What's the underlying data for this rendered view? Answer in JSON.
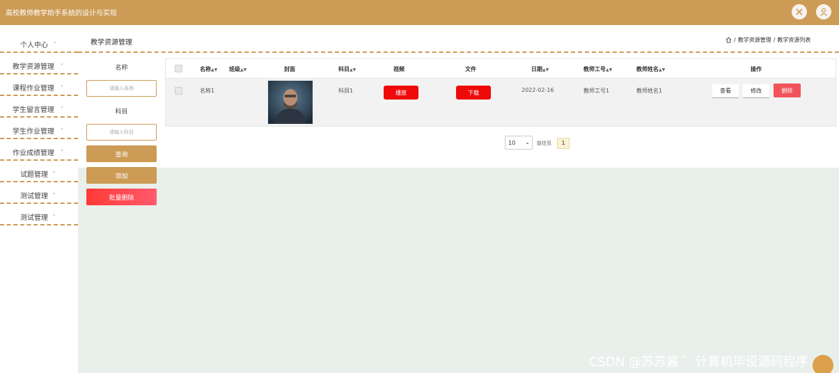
{
  "header": {
    "title": "高校教师教学助手系统的设计与实现",
    "accent": "#cc9b55"
  },
  "sidebar": {
    "items": [
      {
        "label": "个人中心"
      },
      {
        "label": "教学资源管理"
      },
      {
        "label": "课程作业管理"
      },
      {
        "label": "学生留言管理"
      },
      {
        "label": "学生作业管理"
      },
      {
        "label": "作业成绩管理"
      },
      {
        "label": "试题管理"
      },
      {
        "label": "测试管理"
      },
      {
        "label": "测试管理"
      }
    ]
  },
  "page": {
    "title": "教学资源管理",
    "breadcrumb": [
      "教学资源管理",
      "教学资源列表"
    ],
    "separator": "/"
  },
  "search": {
    "name_label": "名称",
    "name_placeholder": "请输入名称",
    "subject_label": "科目",
    "subject_placeholder": "请输入科目",
    "query_button": "查询",
    "add_button": "添加",
    "batch_delete_button": "批量删除"
  },
  "table": {
    "headers": {
      "name": "名称",
      "class": "班级",
      "cover": "封面",
      "subject": "科目",
      "video": "视频",
      "file": "文件",
      "date": "日期",
      "teacher_id": "教师工号",
      "teacher_name": "教师姓名",
      "actions": "操作"
    },
    "rows": [
      {
        "name": "名称1",
        "class": "",
        "subject": "科目1",
        "video_button": "播放",
        "file_button": "下载",
        "date": "2022-02-16",
        "teacher_id": "教师工号1",
        "teacher_name": "教师姓名1",
        "view": "查看",
        "edit": "修改",
        "delete": "删除"
      }
    ]
  },
  "pagination": {
    "page_size": "10",
    "goto_label": "前往页",
    "current_page": "1"
  },
  "watermark": "CSDN @苏苏酱 ゛计算机毕设源码程序"
}
